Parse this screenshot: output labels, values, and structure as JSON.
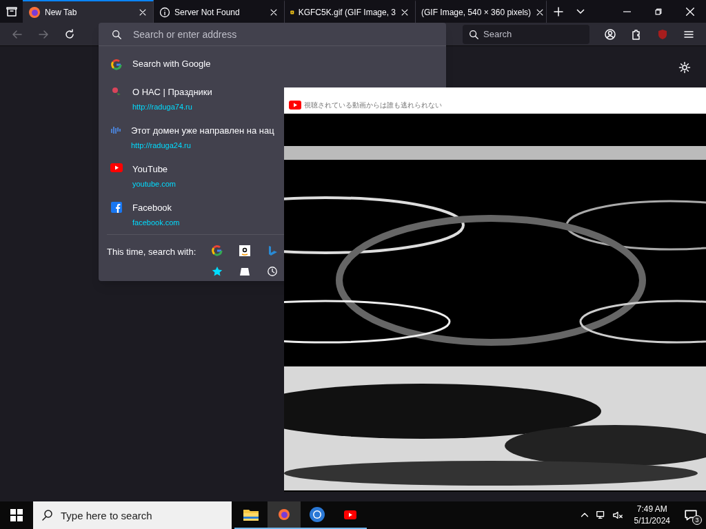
{
  "tabs": [
    {
      "title": "New Tab",
      "selected": true
    },
    {
      "title": "Server Not Found",
      "selected": false
    },
    {
      "title": "KGFC5K.gif (GIF Image, 3",
      "selected": false
    },
    {
      "title": "(GIF Image, 540 × 360 pixels)",
      "selected": false
    }
  ],
  "urlbar": {
    "placeholder": "Search or enter address"
  },
  "search_field": {
    "placeholder": "Search"
  },
  "dropdown": {
    "items": [
      {
        "title": "Search with Google"
      },
      {
        "title": "О НАС | Праздники",
        "url": "http://raduga74.ru"
      },
      {
        "title": "Этот домен уже направлен на нац",
        "url": "http://raduga24.ru"
      },
      {
        "title": "YouTube",
        "url": "youtube.com"
      },
      {
        "title": "Facebook",
        "url": "facebook.com"
      }
    ],
    "one_off_label": "This time, search with:"
  },
  "video_title": "視聴されている動画からは誰も逃れられない",
  "taskbar": {
    "search_placeholder": "Type here to search",
    "time": "7:49 AM",
    "date": "5/11/2024",
    "notifications": "3",
    "apps": [
      {
        "selected": false
      },
      {
        "selected": true
      },
      {
        "selected": false
      },
      {
        "selected": false
      }
    ]
  }
}
